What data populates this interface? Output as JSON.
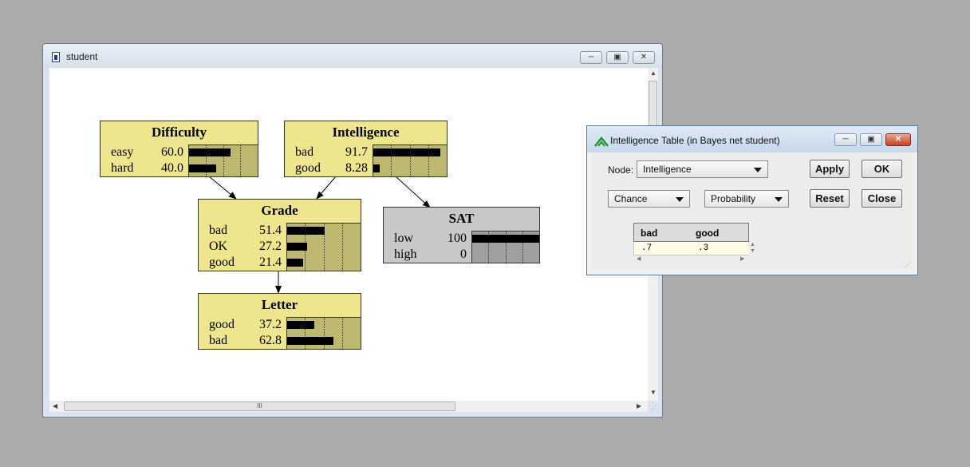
{
  "main_window": {
    "title": "student",
    "scrollbar_grip": "III"
  },
  "nodes": [
    {
      "id": "difficulty",
      "title": "Difficulty",
      "style": "belief",
      "states": [
        {
          "label": "easy",
          "value": "60.0",
          "prob": 0.6
        },
        {
          "label": "hard",
          "value": "40.0",
          "prob": 0.4
        }
      ]
    },
    {
      "id": "intelligence",
      "title": "Intelligence",
      "style": "belief",
      "states": [
        {
          "label": "bad",
          "value": "91.7",
          "prob": 0.917
        },
        {
          "label": "good",
          "value": "8.28",
          "prob": 0.0828
        }
      ]
    },
    {
      "id": "grade",
      "title": "Grade",
      "style": "belief",
      "states": [
        {
          "label": "bad",
          "value": "51.4",
          "prob": 0.514
        },
        {
          "label": "OK",
          "value": "27.2",
          "prob": 0.272
        },
        {
          "label": "good",
          "value": "21.4",
          "prob": 0.214
        }
      ]
    },
    {
      "id": "sat",
      "title": "SAT",
      "style": "evidence",
      "states": [
        {
          "label": "low",
          "value": "100",
          "prob": 1.0
        },
        {
          "label": "high",
          "value": "0",
          "prob": 0.0
        }
      ]
    },
    {
      "id": "letter",
      "title": "Letter",
      "style": "belief",
      "states": [
        {
          "label": "good",
          "value": "37.2",
          "prob": 0.372
        },
        {
          "label": "bad",
          "value": "62.8",
          "prob": 0.628
        }
      ]
    }
  ],
  "dialog": {
    "title": "Intelligence Table (in Bayes net student)",
    "node_label": "Node:",
    "node_value": "Intelligence",
    "node_type": "Chance",
    "table_type": "Probability",
    "buttons": {
      "apply": "Apply",
      "ok": "OK",
      "reset": "Reset",
      "close": "Close"
    },
    "table": {
      "headers": [
        "bad",
        "good"
      ],
      "row": [
        ".7",
        ".3"
      ]
    }
  }
}
